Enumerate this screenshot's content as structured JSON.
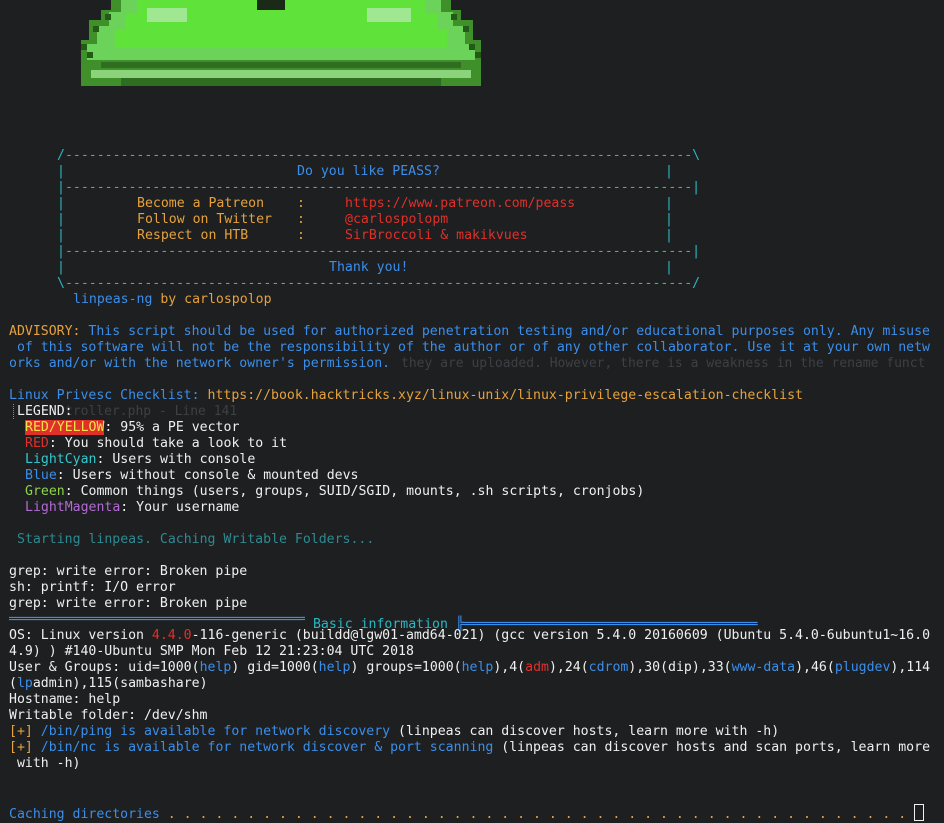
{
  "banner": {
    "title": "Do you like PEASS?",
    "rows": [
      {
        "label": "Become a Patreon",
        "sep": ":",
        "value": "https://www.patreon.com/peass"
      },
      {
        "label": "Follow on Twitter",
        "sep": ":",
        "value": "@carlospolopm"
      },
      {
        "label": "Respect on HTB",
        "sep": ":",
        "value": "SirBroccoli & makikvues"
      }
    ],
    "thanks": "Thank you!",
    "author_tool": "linpeas-ng",
    "author_by": " by ",
    "author_name": "carlospolop"
  },
  "advisory": {
    "label": "ADVISORY:",
    "line1": " This script should be used for authorized penetration testing and/or educational purposes only. Any misuse",
    "line2": " of this software will not be the responsibility of the author or of any other collaborator. Use it at your own netw",
    "line3": "orks and/or with the network owner's permission."
  },
  "checklist": {
    "label": "Linux Privesc Checklist:",
    "url": " https://book.hacktricks.xyz/linux-unix/linux-privilege-escalation-checklist"
  },
  "legend": {
    "title": "LEGEND:",
    "items": [
      {
        "name": "RED/YELLOW",
        "desc": ": 95% a PE vector"
      },
      {
        "name": "RED",
        "desc": ": You should take a look to it"
      },
      {
        "name": "LightCyan",
        "desc": ": Users with console"
      },
      {
        "name": "Blue",
        "desc": ": Users without console & mounted devs"
      },
      {
        "name": "Green",
        "desc": ": Common things (users, groups, SUID/SGID, mounts, .sh scripts, cronjobs)"
      },
      {
        "name": "LightMagenta",
        "desc": ": Your username"
      }
    ]
  },
  "status": {
    "starting": "Starting linpeas. Caching Writable Folders...",
    "errors": [
      "grep: write error: Broken pipe",
      "sh: printf: I/O error",
      "grep: write error: Broken pipe"
    ]
  },
  "section": {
    "left_rule": "═════════════════════════════════════╣",
    "title": " Basic information ",
    "right_rule": "╠═════════════════════════════════════"
  },
  "info": {
    "os_pre": "OS: Linux version ",
    "os_ver": "4.4.0",
    "os_post": "-116-generic (buildd@lgw01-amd64-021) (gcc version 5.4.0 20160609 (Ubuntu 5.4.0-6ubuntu1~16.0",
    "os_line2": "4.9) ) #140-Ubuntu SMP Mon Feb 12 21:23:04 UTC 2018",
    "ug_pre": "User & Groups: uid=1000(",
    "help": "help",
    "ug_mid1": ") gid=1000(",
    "ug_mid2": ") groups=1000(",
    "ug_mid3": "),4(",
    "adm": "adm",
    "ug_mid4": "),24(",
    "cdrom": "cdrom",
    "ug_mid5": "),30(dip),33(",
    "wwwdata": "www-data",
    "ug_mid6": "),46(",
    "plugdev": "plugdev",
    "ug_mid7": "),114",
    "ug_line2_pre": "(",
    "lp": "lp",
    "ug_line2_post": "admin),115(sambashare)",
    "hostname": "Hostname: help",
    "writable": "Writable folder: /dev/shm",
    "plus": "[+]",
    "ping": " /bin/ping is available for network discovery",
    "ping_post": " (linpeas can discover hosts, learn more with -h)",
    "nc": " /bin/nc is available for network discover & port scanning",
    "nc_post": " (linpeas can discover hosts and scan ports, learn more",
    "nc_line2": " with -h)",
    "caching": "Caching directories",
    "dots": " . . . . . . . . . . . . . . . . . . . . . . . . . . . . . . . . . . . . . . . . . . . . . . . "
  },
  "ghost": {
    "g1": "they are uploaded. However, there is a weakness in the rename funct",
    "g2": "troller.php - Line 141"
  },
  "colors": {
    "background": "#1d1f21",
    "cyan": "#2bb8c4",
    "blue": "#3b8eea",
    "orange": "#e6a23c",
    "red": "#e0302a",
    "frog_green": "#5fe33a"
  }
}
